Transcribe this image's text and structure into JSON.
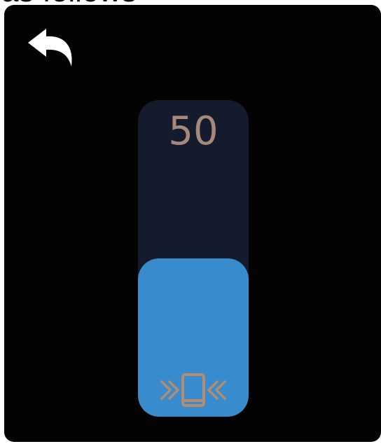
{
  "caption": "as follows",
  "icons": {
    "back": "undo-arrow-icon",
    "vibration": "phone-vibrate-icon"
  },
  "slider": {
    "value_text": "50",
    "level_fraction": 0.5
  },
  "colors": {
    "screen_bg": "#030303",
    "track": "#141b2c",
    "fill": "#388bcc",
    "value_text": "#a58a7c",
    "icon": "#b58c6e",
    "back_icon": "#ffffff"
  }
}
